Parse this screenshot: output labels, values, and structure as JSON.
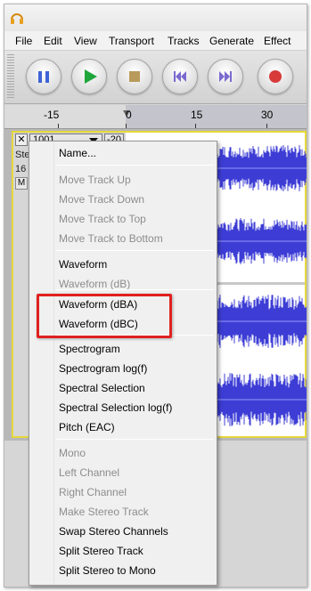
{
  "menubar": {
    "items": [
      "File",
      "Edit",
      "View",
      "Transport",
      "Tracks",
      "Generate",
      "Effect"
    ]
  },
  "toolbar": {
    "buttons": [
      "pause",
      "play",
      "stop",
      "skip-to-start",
      "skip-to-end",
      "record"
    ]
  },
  "ruler": {
    "ticks": [
      "-15",
      "0",
      "15",
      "30"
    ]
  },
  "track": {
    "name": "1001",
    "scale_label": "-20",
    "info_line1": "Ste",
    "info_line2": "16",
    "mute_label": "M"
  },
  "context_menu": {
    "items": [
      {
        "label": "Name...",
        "enabled": true
      },
      {
        "label": "Move Track Up",
        "enabled": false
      },
      {
        "label": "Move Track Down",
        "enabled": false
      },
      {
        "label": "Move Track to Top",
        "enabled": false
      },
      {
        "label": "Move Track to Bottom",
        "enabled": false
      },
      {
        "label": "Waveform",
        "enabled": true
      },
      {
        "label": "Waveform (dB)",
        "enabled": false
      },
      {
        "label": "Waveform (dBA)",
        "enabled": true
      },
      {
        "label": "Waveform (dBC)",
        "enabled": true
      },
      {
        "label": "Spectrogram",
        "enabled": true
      },
      {
        "label": "Spectrogram log(f)",
        "enabled": true
      },
      {
        "label": "Spectral Selection",
        "enabled": true
      },
      {
        "label": "Spectral Selection log(f)",
        "enabled": true
      },
      {
        "label": "Pitch (EAC)",
        "enabled": true
      },
      {
        "label": "Mono",
        "enabled": false
      },
      {
        "label": "Left Channel",
        "enabled": false
      },
      {
        "label": "Right Channel",
        "enabled": false
      },
      {
        "label": "Make Stereo Track",
        "enabled": false
      },
      {
        "label": "Swap Stereo Channels",
        "enabled": true
      },
      {
        "label": "Split Stereo Track",
        "enabled": true
      },
      {
        "label": "Split Stereo to Mono",
        "enabled": true
      }
    ]
  },
  "colors": {
    "waveform": "#3d3dd6",
    "highlight": "#e02020",
    "track_border": "#e6d83c"
  }
}
